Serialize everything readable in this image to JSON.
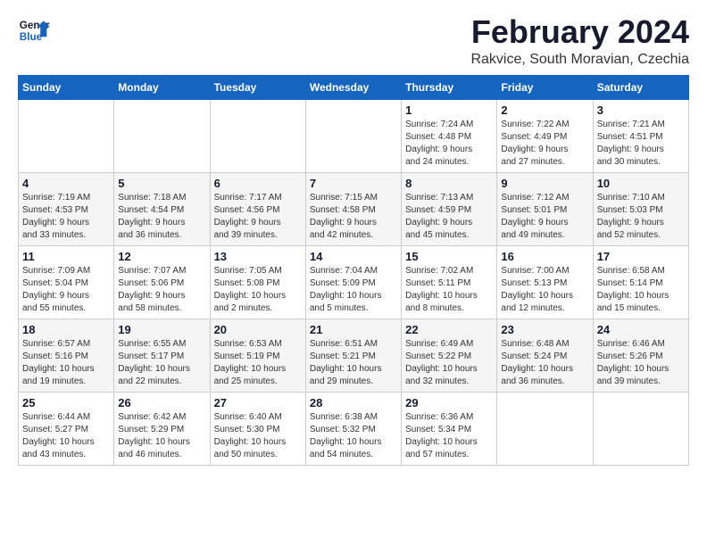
{
  "header": {
    "logo_line1": "General",
    "logo_line2": "Blue",
    "title": "February 2024",
    "subtitle": "Rakvice, South Moravian, Czechia"
  },
  "days_of_week": [
    "Sunday",
    "Monday",
    "Tuesday",
    "Wednesday",
    "Thursday",
    "Friday",
    "Saturday"
  ],
  "weeks": [
    [
      {
        "day": "",
        "info": ""
      },
      {
        "day": "",
        "info": ""
      },
      {
        "day": "",
        "info": ""
      },
      {
        "day": "",
        "info": ""
      },
      {
        "day": "1",
        "info": "Sunrise: 7:24 AM\nSunset: 4:48 PM\nDaylight: 9 hours\nand 24 minutes."
      },
      {
        "day": "2",
        "info": "Sunrise: 7:22 AM\nSunset: 4:49 PM\nDaylight: 9 hours\nand 27 minutes."
      },
      {
        "day": "3",
        "info": "Sunrise: 7:21 AM\nSunset: 4:51 PM\nDaylight: 9 hours\nand 30 minutes."
      }
    ],
    [
      {
        "day": "4",
        "info": "Sunrise: 7:19 AM\nSunset: 4:53 PM\nDaylight: 9 hours\nand 33 minutes."
      },
      {
        "day": "5",
        "info": "Sunrise: 7:18 AM\nSunset: 4:54 PM\nDaylight: 9 hours\nand 36 minutes."
      },
      {
        "day": "6",
        "info": "Sunrise: 7:17 AM\nSunset: 4:56 PM\nDaylight: 9 hours\nand 39 minutes."
      },
      {
        "day": "7",
        "info": "Sunrise: 7:15 AM\nSunset: 4:58 PM\nDaylight: 9 hours\nand 42 minutes."
      },
      {
        "day": "8",
        "info": "Sunrise: 7:13 AM\nSunset: 4:59 PM\nDaylight: 9 hours\nand 45 minutes."
      },
      {
        "day": "9",
        "info": "Sunrise: 7:12 AM\nSunset: 5:01 PM\nDaylight: 9 hours\nand 49 minutes."
      },
      {
        "day": "10",
        "info": "Sunrise: 7:10 AM\nSunset: 5:03 PM\nDaylight: 9 hours\nand 52 minutes."
      }
    ],
    [
      {
        "day": "11",
        "info": "Sunrise: 7:09 AM\nSunset: 5:04 PM\nDaylight: 9 hours\nand 55 minutes."
      },
      {
        "day": "12",
        "info": "Sunrise: 7:07 AM\nSunset: 5:06 PM\nDaylight: 9 hours\nand 58 minutes."
      },
      {
        "day": "13",
        "info": "Sunrise: 7:05 AM\nSunset: 5:08 PM\nDaylight: 10 hours\nand 2 minutes."
      },
      {
        "day": "14",
        "info": "Sunrise: 7:04 AM\nSunset: 5:09 PM\nDaylight: 10 hours\nand 5 minutes."
      },
      {
        "day": "15",
        "info": "Sunrise: 7:02 AM\nSunset: 5:11 PM\nDaylight: 10 hours\nand 8 minutes."
      },
      {
        "day": "16",
        "info": "Sunrise: 7:00 AM\nSunset: 5:13 PM\nDaylight: 10 hours\nand 12 minutes."
      },
      {
        "day": "17",
        "info": "Sunrise: 6:58 AM\nSunset: 5:14 PM\nDaylight: 10 hours\nand 15 minutes."
      }
    ],
    [
      {
        "day": "18",
        "info": "Sunrise: 6:57 AM\nSunset: 5:16 PM\nDaylight: 10 hours\nand 19 minutes."
      },
      {
        "day": "19",
        "info": "Sunrise: 6:55 AM\nSunset: 5:17 PM\nDaylight: 10 hours\nand 22 minutes."
      },
      {
        "day": "20",
        "info": "Sunrise: 6:53 AM\nSunset: 5:19 PM\nDaylight: 10 hours\nand 25 minutes."
      },
      {
        "day": "21",
        "info": "Sunrise: 6:51 AM\nSunset: 5:21 PM\nDaylight: 10 hours\nand 29 minutes."
      },
      {
        "day": "22",
        "info": "Sunrise: 6:49 AM\nSunset: 5:22 PM\nDaylight: 10 hours\nand 32 minutes."
      },
      {
        "day": "23",
        "info": "Sunrise: 6:48 AM\nSunset: 5:24 PM\nDaylight: 10 hours\nand 36 minutes."
      },
      {
        "day": "24",
        "info": "Sunrise: 6:46 AM\nSunset: 5:26 PM\nDaylight: 10 hours\nand 39 minutes."
      }
    ],
    [
      {
        "day": "25",
        "info": "Sunrise: 6:44 AM\nSunset: 5:27 PM\nDaylight: 10 hours\nand 43 minutes."
      },
      {
        "day": "26",
        "info": "Sunrise: 6:42 AM\nSunset: 5:29 PM\nDaylight: 10 hours\nand 46 minutes."
      },
      {
        "day": "27",
        "info": "Sunrise: 6:40 AM\nSunset: 5:30 PM\nDaylight: 10 hours\nand 50 minutes."
      },
      {
        "day": "28",
        "info": "Sunrise: 6:38 AM\nSunset: 5:32 PM\nDaylight: 10 hours\nand 54 minutes."
      },
      {
        "day": "29",
        "info": "Sunrise: 6:36 AM\nSunset: 5:34 PM\nDaylight: 10 hours\nand 57 minutes."
      },
      {
        "day": "",
        "info": ""
      },
      {
        "day": "",
        "info": ""
      }
    ]
  ]
}
